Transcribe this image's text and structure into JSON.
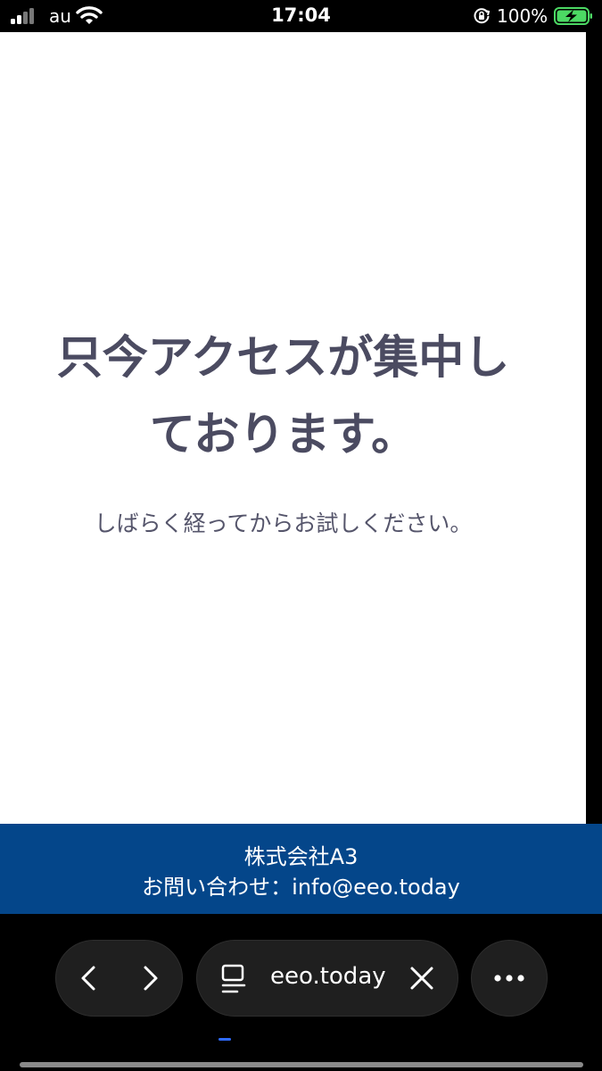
{
  "status_bar": {
    "carrier": "au",
    "time": "17:04",
    "battery_percent": "100%",
    "battery_level": 1.0,
    "charging": true,
    "colors": {
      "battery_fill": "#4cd964"
    }
  },
  "page": {
    "headline_line1": "只今アクセスが集中し",
    "headline_line2": "ております。",
    "subtext": "しばらく経ってからお試しください。",
    "colors": {
      "text": "#4b4b61",
      "background": "#ffffff"
    }
  },
  "footer": {
    "company": "株式会社A3",
    "contact": "お問い合わせ：info@eeo.today",
    "colors": {
      "background": "#04468a",
      "text": "#ffffff"
    }
  },
  "browser_toolbar": {
    "url": "eeo.today",
    "icons": {
      "back": "chevron-left-icon",
      "forward": "chevron-right-icon",
      "reader": "page-menu-icon",
      "clear": "close-icon",
      "more": "more-dots-icon"
    }
  }
}
